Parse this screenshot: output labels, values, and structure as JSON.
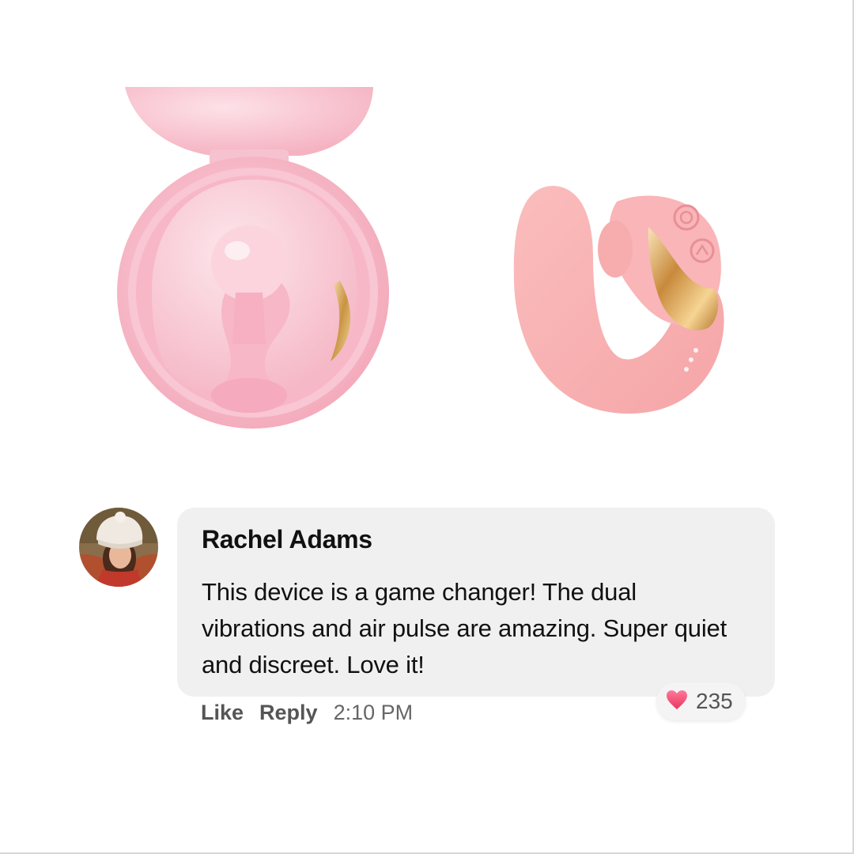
{
  "comment": {
    "author": "Rachel Adams",
    "text": "This device is a game changer! The dual vibrations and air pulse are amazing. Super quiet and discreet. Love it!",
    "actions": {
      "like_label": "Like",
      "reply_label": "Reply"
    },
    "timestamp": "2:10 PM",
    "reaction": {
      "icon": "heart-icon",
      "count": "235"
    }
  },
  "colors": {
    "bubble": "#f0f0f0",
    "product_pink": "#f7b3c3",
    "heart": "#f0466e",
    "text_dark": "#111111",
    "text_muted": "#555555"
  }
}
